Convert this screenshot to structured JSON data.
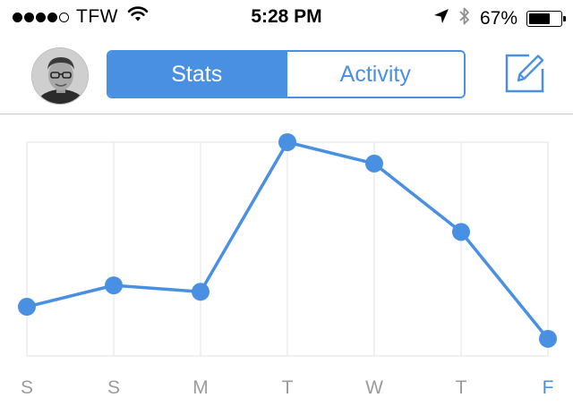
{
  "status_bar": {
    "carrier": "TFW",
    "time": "5:28 PM",
    "battery_percent": "67%",
    "battery_level": 0.67,
    "signal_bars_filled": 4,
    "signal_bars_total": 5
  },
  "nav": {
    "tabs": [
      {
        "label": "Stats",
        "active": true
      },
      {
        "label": "Activity",
        "active": false
      }
    ],
    "compose_icon": "compose-icon",
    "avatar_icon": "avatar"
  },
  "colors": {
    "accent": "#4a90e2",
    "axis_label": "#9b9b9b",
    "grid": "#e3e3e3"
  },
  "chart_data": {
    "type": "line",
    "categories": [
      "S",
      "S",
      "M",
      "T",
      "W",
      "T",
      "F"
    ],
    "values": [
      0.23,
      0.33,
      0.3,
      1.0,
      0.9,
      0.58,
      0.08
    ],
    "ylim": [
      0,
      1
    ],
    "highlighted_category_index": 6,
    "grid": true,
    "title": "",
    "xlabel": "",
    "ylabel": ""
  }
}
